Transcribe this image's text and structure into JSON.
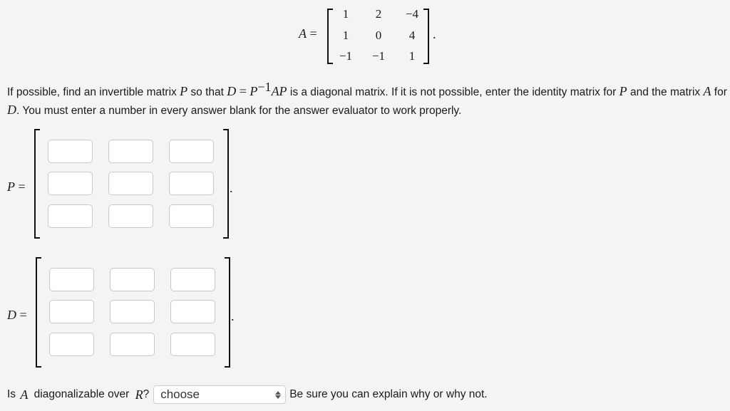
{
  "matrix_A": {
    "label": "A",
    "equals": "=",
    "rows": [
      [
        "1",
        "2",
        "−4"
      ],
      [
        "1",
        "0",
        "4"
      ],
      [
        "−1",
        "−1",
        "1"
      ]
    ],
    "terminator": "."
  },
  "question": {
    "t1": "If possible, find an invertible matrix ",
    "P": "P",
    "t2": " so that ",
    "D": "D",
    "eq": " = ",
    "P2": "P",
    "sup": "−1",
    "AP": "AP",
    "t3": " is a diagonal matrix. If it is not possible, enter the identity matrix for ",
    "P3": "P",
    "t4": " and the matrix ",
    "A": "A",
    "t5": " for ",
    "D2": "D",
    "t6": ". You must enter a number in every answer blank for the answer evaluator to work properly."
  },
  "matrix_P": {
    "label": "P",
    "equals": "=",
    "terminator": ".",
    "values": [
      "",
      "",
      "",
      "",
      "",
      "",
      "",
      "",
      ""
    ]
  },
  "matrix_D": {
    "label": "D",
    "equals": "=",
    "terminator": ".",
    "values": [
      "",
      "",
      "",
      "",
      "",
      "",
      "",
      "",
      ""
    ]
  },
  "diagonalizable": {
    "t1": "Is ",
    "A": "A",
    "t2": " diagonalizable over ",
    "R": "R",
    "t3": "?",
    "select_value": "choose",
    "note": "Be sure you can explain why or why not."
  }
}
